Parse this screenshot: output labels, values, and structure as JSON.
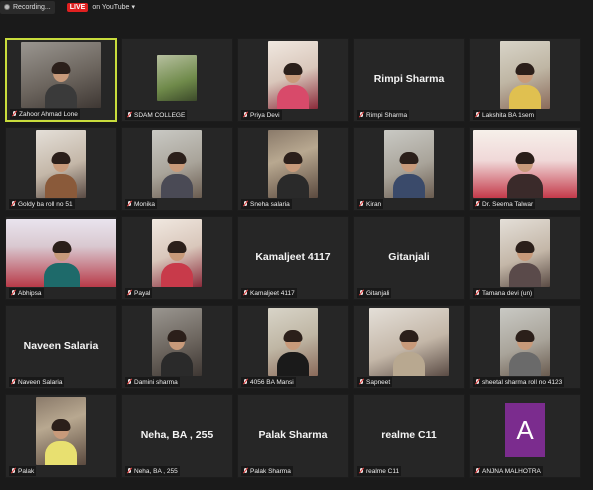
{
  "topbar": {
    "recording_label": "Recording...",
    "live_badge": "LIVE",
    "youtube_label": "on YouTube",
    "dropdown_icon": "chevron-down-icon"
  },
  "colors": {
    "active_border": "#c8dc3c",
    "live_red": "#e02020",
    "avatar_purple": "#7b2c8e",
    "background": "#1a1a1a"
  },
  "participants": [
    {
      "name": "Zahoor Ahmad Lone",
      "active": true,
      "video": true
    },
    {
      "name": "SDAM COLLEGE",
      "video": true
    },
    {
      "name": "Priya Devi",
      "video": true
    },
    {
      "name": "Rimpi Sharma",
      "display_name": "Rimpi Sharma",
      "video": false
    },
    {
      "name": "Lakshita BA 1sem",
      "video": true
    },
    {
      "name": "Goldy ba roll no 51",
      "video": true
    },
    {
      "name": "Monika",
      "video": true
    },
    {
      "name": "Sneha salaria",
      "video": true
    },
    {
      "name": "Kiran",
      "video": true
    },
    {
      "name": "Dr. Seema Talwar",
      "video": true
    },
    {
      "name": "Abhipsa",
      "video": true
    },
    {
      "name": "Payal",
      "video": true
    },
    {
      "name": "Kamaljeet 4117",
      "display_name": "Kamaljeet 4117",
      "video": false
    },
    {
      "name": "Gitanjali",
      "display_name": "Gitanjali",
      "video": false
    },
    {
      "name": "Tamana devi (un)",
      "video": true
    },
    {
      "name": "Naveen Salaria",
      "display_name": "Naveen Salaria",
      "video": false
    },
    {
      "name": "Damini sharma",
      "video": true
    },
    {
      "name": "4056 BA Mansi",
      "video": true
    },
    {
      "name": "Sapneet",
      "video": true
    },
    {
      "name": "sheetal sharma roll no 4123",
      "video": true
    },
    {
      "name": "Palak",
      "video": true
    },
    {
      "name": "Neha, BA , 255",
      "display_name": "Neha, BA , 255",
      "video": false
    },
    {
      "name": "Palak Sharma",
      "display_name": "Palak Sharma",
      "video": false
    },
    {
      "name": "realme C11",
      "display_name": "realme C11",
      "video": false
    },
    {
      "name": "ANJNA MALHOTRA",
      "avatar_letter": "A",
      "video": false
    }
  ]
}
